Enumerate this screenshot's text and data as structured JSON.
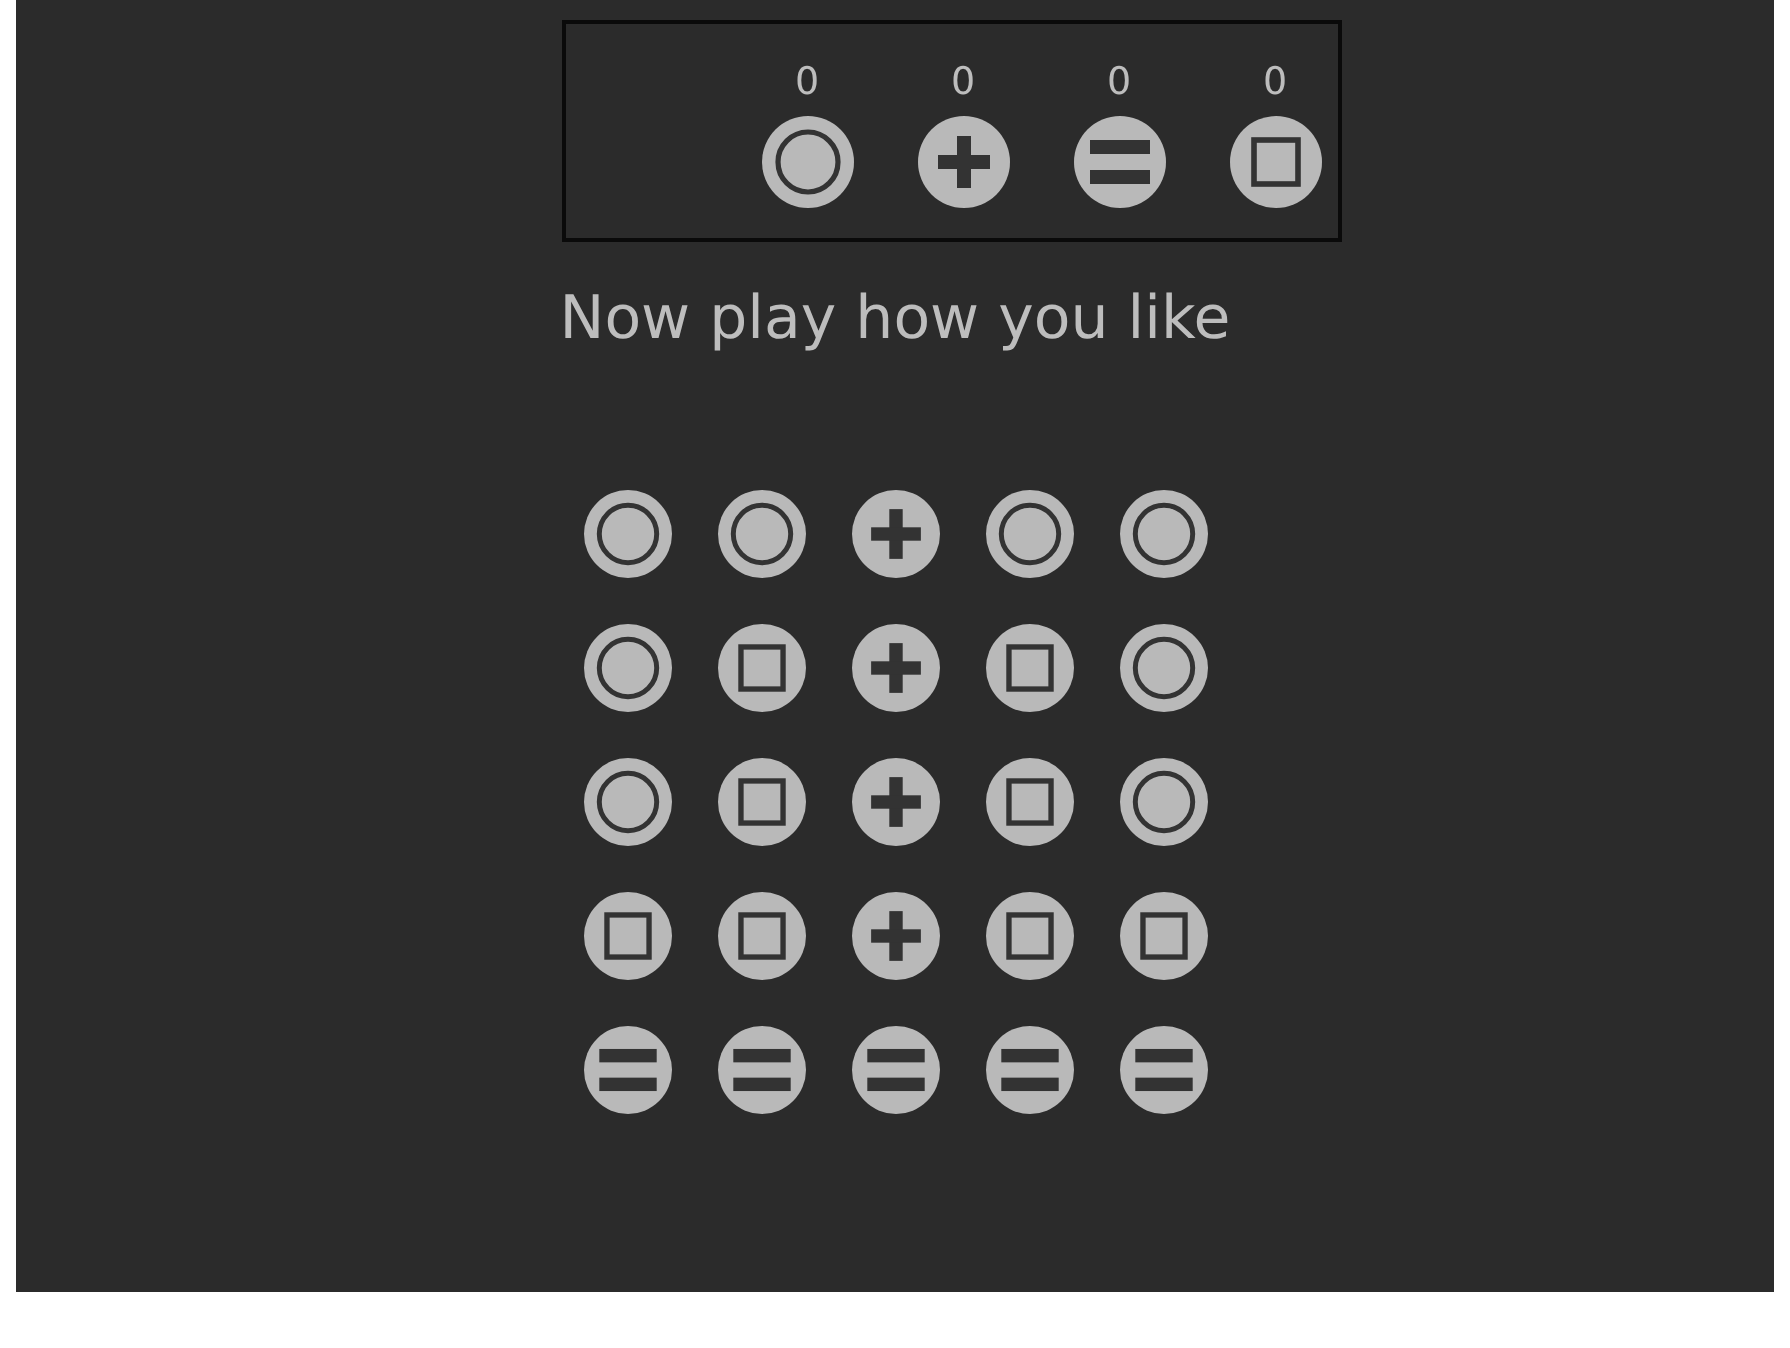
{
  "scoreboard": [
    {
      "kind": "ring",
      "count": "0"
    },
    {
      "kind": "plus",
      "count": "0"
    },
    {
      "kind": "equals",
      "count": "0"
    },
    {
      "kind": "square",
      "count": "0"
    }
  ],
  "message": "Now play how you like",
  "grid": [
    [
      {
        "kind": "ring"
      },
      {
        "kind": "ring"
      },
      {
        "kind": "plus"
      },
      {
        "kind": "ring"
      },
      {
        "kind": "ring"
      }
    ],
    [
      {
        "kind": "ring"
      },
      {
        "kind": "square"
      },
      {
        "kind": "plus"
      },
      {
        "kind": "square"
      },
      {
        "kind": "ring"
      }
    ],
    [
      {
        "kind": "ring"
      },
      {
        "kind": "square"
      },
      {
        "kind": "plus"
      },
      {
        "kind": "square"
      },
      {
        "kind": "ring"
      }
    ],
    [
      {
        "kind": "square"
      },
      {
        "kind": "square"
      },
      {
        "kind": "plus"
      },
      {
        "kind": "square"
      },
      {
        "kind": "square"
      }
    ],
    [
      {
        "kind": "equals"
      },
      {
        "kind": "equals"
      },
      {
        "kind": "equals"
      },
      {
        "kind": "equals"
      },
      {
        "kind": "equals"
      }
    ]
  ]
}
